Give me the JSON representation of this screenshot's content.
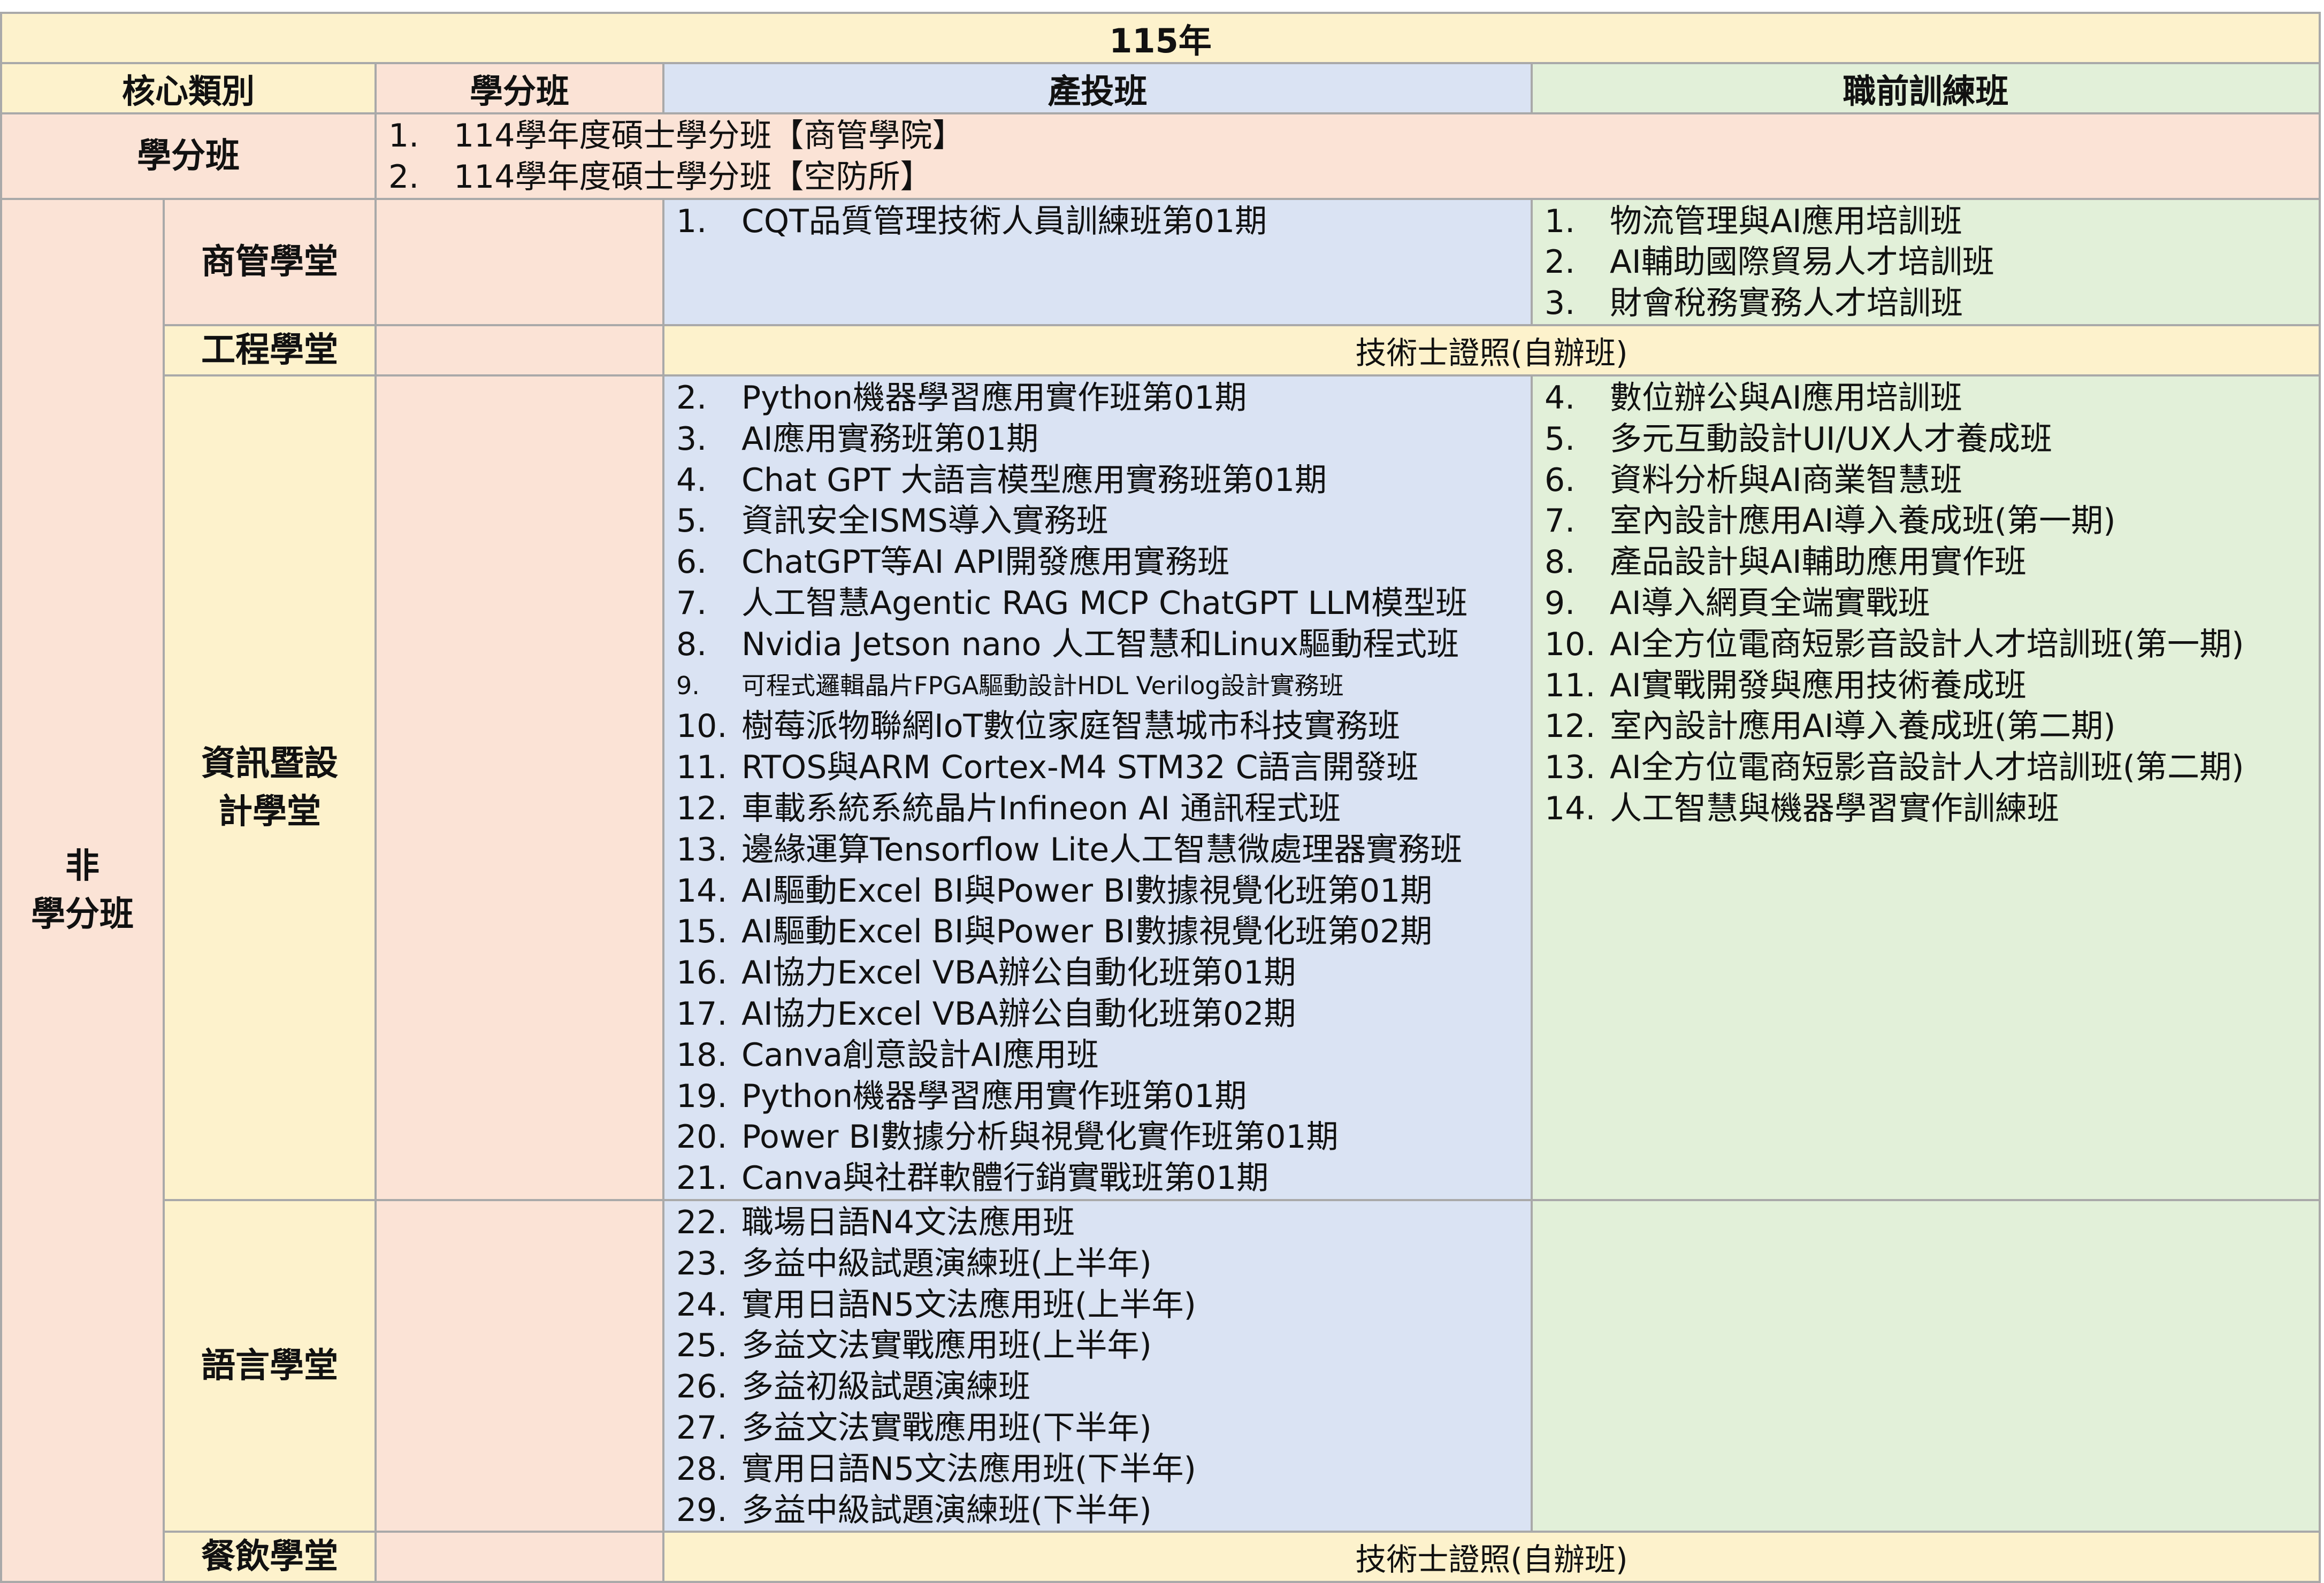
{
  "title": "115年",
  "headers": {
    "core": "核心類別",
    "credit": "學分班",
    "industry": "產投班",
    "pretraining": "職前訓練班"
  },
  "credit_row": {
    "label": "學分班",
    "items": [
      {
        "num": "1.",
        "text": "114學年度碩士學分班【商管學院】"
      },
      {
        "num": "2.",
        "text": "114學年度碩士學分班【空防所】"
      }
    ]
  },
  "noncredit": {
    "label_line1": "非",
    "label_line2": "學分班",
    "business": {
      "label": "商管學堂",
      "industry": [
        {
          "num": "1.",
          "text": "CQT品質管理技術人員訓練班第01期"
        }
      ],
      "pretraining": [
        {
          "num": "1.",
          "text": "物流管理與AI應用培訓班"
        },
        {
          "num": "2.",
          "text": "AI輔助國際貿易人才培訓班"
        },
        {
          "num": "3.",
          "text": "財會稅務實務人才培訓班"
        }
      ]
    },
    "engineering": {
      "label": "工程學堂",
      "merged": "技術士證照(自辦班)"
    },
    "it_design": {
      "label_line1": "資訊暨設",
      "label_line2": "計學堂",
      "industry": [
        {
          "num": "2.",
          "text": "Python機器學習應用實作班第01期"
        },
        {
          "num": "3.",
          "text": "AI應用實務班第01期"
        },
        {
          "num": "4.",
          "text": "Chat GPT 大語言模型應用實務班第01期"
        },
        {
          "num": "5.",
          "text": "資訊安全ISMS導入實務班"
        },
        {
          "num": "6.",
          "text": "ChatGPT等AI API開發應用實務班"
        },
        {
          "num": "7.",
          "text": "人工智慧Agentic RAG MCP ChatGPT LLM模型班"
        },
        {
          "num": "8.",
          "text": "Nvidia Jetson nano 人工智慧和Linux驅動程式班"
        },
        {
          "num": "9.",
          "text": "可程式邏輯晶片FPGA驅動設計HDL Verilog設計實務班"
        },
        {
          "num": "10.",
          "text": "樹莓派物聯網IoT數位家庭智慧城市科技實務班"
        },
        {
          "num": "11.",
          "text": "RTOS與ARM Cortex-M4 STM32 C語言開發班"
        },
        {
          "num": "12.",
          "text": "車載系統系統晶片Infineon AI 通訊程式班"
        },
        {
          "num": "13.",
          "text": "邊緣運算Tensorflow Lite人工智慧微處理器實務班"
        },
        {
          "num": "14.",
          "text": "AI驅動Excel BI與Power BI數據視覺化班第01期"
        },
        {
          "num": "15.",
          "text": "AI驅動Excel BI與Power BI數據視覺化班第02期"
        },
        {
          "num": "16.",
          "text": "AI協力Excel VBA辦公自動化班第01期"
        },
        {
          "num": "17.",
          "text": "AI協力Excel VBA辦公自動化班第02期"
        },
        {
          "num": "18.",
          "text": "Canva創意設計AI應用班"
        },
        {
          "num": "19.",
          "text": "Python機器學習應用實作班第01期"
        },
        {
          "num": "20.",
          "text": "Power BI數據分析與視覺化實作班第01期"
        },
        {
          "num": "21.",
          "text": "Canva與社群軟體行銷實戰班第01期"
        }
      ],
      "pretraining": [
        {
          "num": "4.",
          "text": "數位辦公與AI應用培訓班"
        },
        {
          "num": "5.",
          "text": "多元互動設計UI/UX人才養成班"
        },
        {
          "num": "6.",
          "text": "資料分析與AI商業智慧班"
        },
        {
          "num": "7.",
          "text": "室內設計應用AI導入養成班(第一期)"
        },
        {
          "num": "8.",
          "text": "產品設計與AI輔助應用實作班"
        },
        {
          "num": "9.",
          "text": "AI導入網頁全端實戰班"
        },
        {
          "num": "10.",
          "text": "AI全方位電商短影音設計人才培訓班(第一期)"
        },
        {
          "num": "11.",
          "text": "AI實戰開發與應用技術養成班"
        },
        {
          "num": "12.",
          "text": "室內設計應用AI導入養成班(第二期)"
        },
        {
          "num": "13.",
          "text": "AI全方位電商短影音設計人才培訓班(第二期)"
        },
        {
          "num": "14.",
          "text": "人工智慧與機器學習實作訓練班"
        }
      ]
    },
    "language": {
      "label": "語言學堂",
      "industry": [
        {
          "num": "22.",
          "text": "職場日語N4文法應用班"
        },
        {
          "num": "23.",
          "text": "多益中級試題演練班(上半年)"
        },
        {
          "num": "24.",
          "text": "實用日語N5文法應用班(上半年)"
        },
        {
          "num": "25.",
          "text": "多益文法實戰應用班(上半年)"
        },
        {
          "num": "26.",
          "text": "多益初級試題演練班"
        },
        {
          "num": "27.",
          "text": "多益文法實戰應用班(下半年)"
        },
        {
          "num": "28.",
          "text": "實用日語N5文法應用班(下半年)"
        },
        {
          "num": "29.",
          "text": "多益中級試題演練班(下半年)"
        }
      ]
    },
    "culinary": {
      "label": "餐飲學堂",
      "merged": "技術士證照(自辦班)"
    }
  }
}
